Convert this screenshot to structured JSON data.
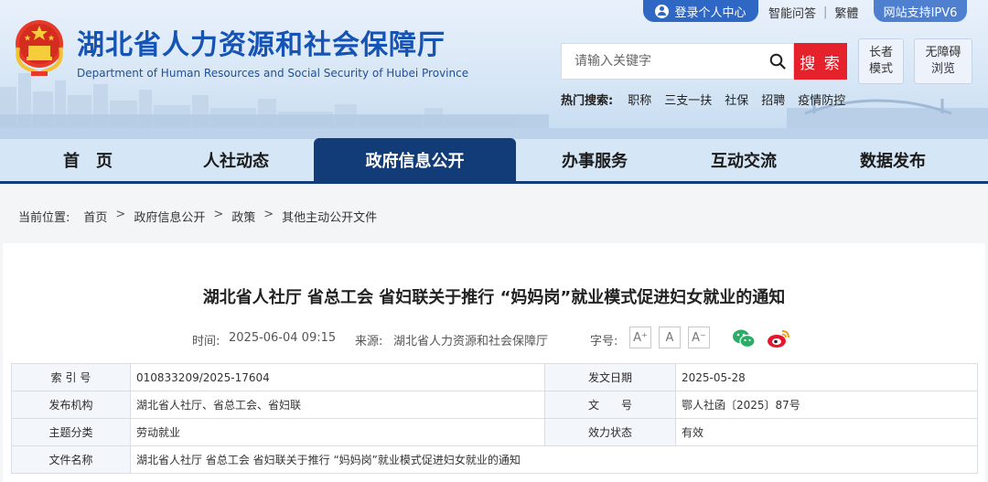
{
  "header": {
    "site_title": "湖北省人力资源和社会保障厅",
    "site_subtitle": "Department of Human Resources and Social Security of Hubei Province",
    "login_label": "登录个人中心",
    "top_links": [
      "智能问答",
      "繁體"
    ],
    "ipv6_label": "网站支持IPV6",
    "search": {
      "placeholder": "请输入关键字",
      "button_label": "搜 索"
    },
    "elder_mode_label": "长者\n模式",
    "accessibility_label": "无障碍\n浏览",
    "hot_search_label": "热门搜索:",
    "hot_search_items": [
      "职称",
      "三支一扶",
      "社保",
      "招聘",
      "疫情防控"
    ],
    "colors": {
      "brand_blue": "#1553b5",
      "search_red": "#e5212c",
      "nav_active": "#123c78"
    }
  },
  "nav": {
    "items": [
      "首　页",
      "人社动态",
      "政府信息公开",
      "办事服务",
      "互动交流",
      "数据发布"
    ],
    "active_label": "政府信息公开"
  },
  "breadcrumb": {
    "label": "当前位置:",
    "items": [
      "首页",
      "政府信息公开",
      "政策",
      "其他主动公开文件"
    ]
  },
  "article": {
    "title": "湖北省人社厅 省总工会 省妇联关于推行 “妈妈岗”就业模式促进妇女就业的通知",
    "time_label": "时间:",
    "time": "2025-06-04 09:15",
    "source_label": "来源:",
    "source": "湖北省人力资源和社会保障厅",
    "font_size_label": "字号:",
    "font_buttons": [
      "A⁺",
      "A",
      "A⁻"
    ],
    "share_icons": [
      "wechat-icon",
      "weibo-icon"
    ]
  },
  "info_table": {
    "rows": [
      {
        "label1": "索 引 号",
        "value1": "010833209/2025-17604",
        "label2": "发文日期",
        "value2": "2025-05-28"
      },
      {
        "label1": "发布机构",
        "value1": "湖北省人社厅、省总工会、省妇联",
        "label2": "文　　号",
        "value2": "鄂人社函〔2025〕87号"
      },
      {
        "label1": "主题分类",
        "value1": "劳动就业",
        "label2": "效力状态",
        "value2": "有效"
      }
    ],
    "file_name_label": "文件名称",
    "file_name": "湖北省人社厅 省总工会 省妇联关于推行 “妈妈岗”就业模式促进妇女就业的通知"
  }
}
